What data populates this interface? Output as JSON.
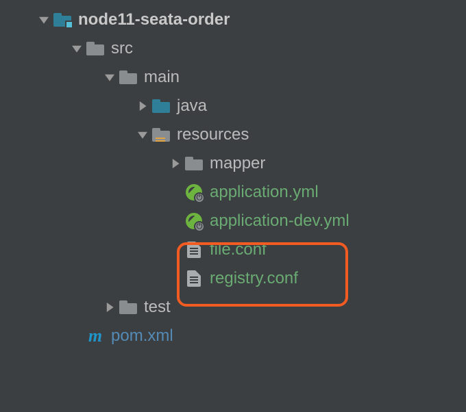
{
  "tree": {
    "root": {
      "label": "node11-seata-order",
      "children": {
        "src": {
          "label": "src",
          "children": {
            "main": {
              "label": "main",
              "children": {
                "java": {
                  "label": "java"
                },
                "resources": {
                  "label": "resources",
                  "children": {
                    "mapper": {
                      "label": "mapper"
                    },
                    "app_yml": {
                      "label": "application.yml"
                    },
                    "app_dev_yml": {
                      "label": "application-dev.yml"
                    },
                    "file_conf": {
                      "label": "file.conf"
                    },
                    "registry_conf": {
                      "label": "registry.conf"
                    }
                  }
                }
              }
            },
            "test": {
              "label": "test"
            }
          }
        },
        "pom": {
          "label": "pom.xml"
        }
      }
    }
  },
  "highlight": {
    "files": [
      "file.conf",
      "registry.conf"
    ]
  }
}
